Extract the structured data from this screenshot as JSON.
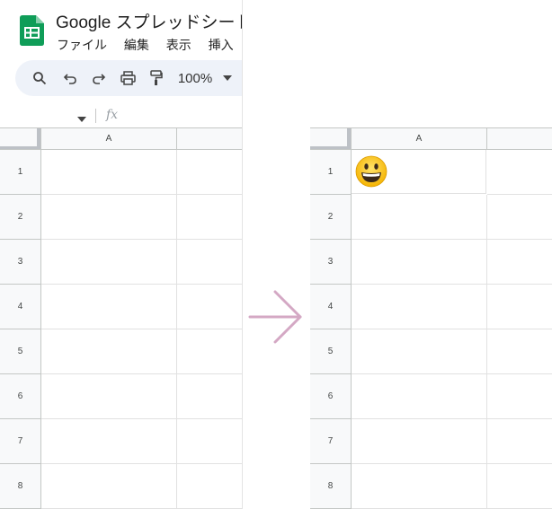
{
  "app": {
    "title": "Google スプレッドシート",
    "menu": [
      "ファイル",
      "編集",
      "表示",
      "挿入"
    ]
  },
  "toolbar": {
    "zoom": "100%",
    "icons": [
      "search-icon",
      "undo-icon",
      "redo-icon",
      "print-icon",
      "paint-format-icon",
      "chevron-down-icon"
    ]
  },
  "formula_bar": {
    "fx": "fx"
  },
  "sheet_before": {
    "columns": [
      "A"
    ],
    "rows": [
      "1",
      "2",
      "3",
      "4",
      "5",
      "6",
      "7",
      "8"
    ]
  },
  "sheet_after": {
    "columns": [
      "A"
    ],
    "rows": [
      "1",
      "2",
      "3",
      "4",
      "5",
      "6",
      "7",
      "8"
    ],
    "cell_A1": "😀"
  },
  "colors": {
    "sheets_green": "#0f9d58",
    "arrow": "#d4a8c4",
    "toolbar_bg": "#eef2f9",
    "header_bg": "#f8f9fa"
  }
}
